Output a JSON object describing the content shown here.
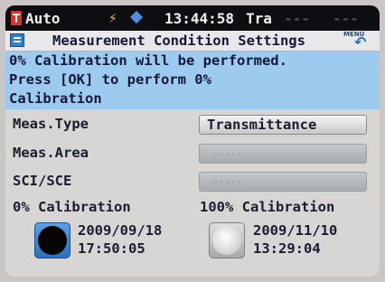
{
  "status": {
    "mode": "Auto",
    "bolt_icon": "⚡",
    "time": "13:44:58",
    "type": "Tra",
    "dash1": "---",
    "dash2": "---",
    "colors": {
      "bar": "#0e0e12",
      "logo": "#d8332a",
      "bolt": "#f0c020"
    }
  },
  "title": {
    "text": "Measurement Condition Settings",
    "menu_label": "MENU",
    "back_icon": "↶"
  },
  "message": {
    "lines": [
      "0% Calibration will be performed.",
      "Press [OK] to perform 0%",
      "Calibration"
    ],
    "background": "#9ccbef"
  },
  "settings": {
    "meas_type": {
      "label": "Meas.Type",
      "value": "Transmittance"
    },
    "meas_area": {
      "label": "Meas.Area",
      "value": "-----"
    },
    "sci_sce": {
      "label": "SCI/SCE",
      "value": "-----"
    }
  },
  "calibration": {
    "zero": {
      "heading": "0% Calibration",
      "date": "2009/09/18",
      "time": "17:50:05"
    },
    "hundred": {
      "heading": "100% Calibration",
      "date": "2009/11/10",
      "time": "13:29:04"
    }
  }
}
